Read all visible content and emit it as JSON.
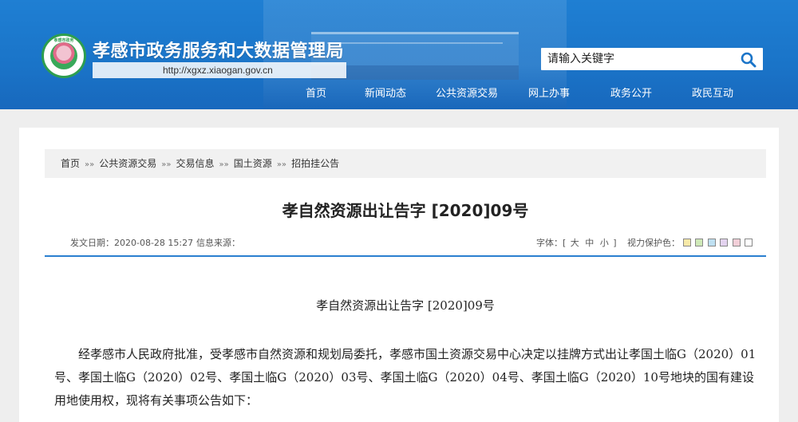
{
  "header": {
    "logo_text": "孝感市政务",
    "site_title": "孝感市政务服务和大数据管理局",
    "site_url": "http://xgxz.xiaogan.gov.cn",
    "search": {
      "placeholder": "请输入关键字"
    },
    "nav": [
      "首页",
      "新闻动态",
      "公共资源交易",
      "网上办事",
      "政务公开",
      "政民互动"
    ]
  },
  "breadcrumb": [
    "首页",
    "公共资源交易",
    "交易信息",
    "国土资源",
    "招拍挂公告"
  ],
  "breadcrumb_separator": "»»",
  "article": {
    "title": "孝自然资源出让告字 [2020]09号",
    "meta": {
      "date_label": "发文日期：2020-08-28 15:27",
      "source_label": "信息来源：",
      "font_label": "字体：[",
      "font_options": [
        "大",
        "中",
        "小"
      ],
      "font_close": "]",
      "vision_label": "视力保护色："
    },
    "vision_colors": [
      "#f7e9a8",
      "#cfe9b8",
      "#bfe0f2",
      "#e3d3ef",
      "#f2cfd8",
      "#ffffff"
    ],
    "doc_heading": "孝自然资源出让告字 [2020]09号",
    "paragraph": "经孝感市人民政府批准，受孝感市自然资源和规划局委托，孝感市国土资源交易中心决定以挂牌方式出让孝国土临G（2020）01号、孝国土临G（2020）02号、孝国土临G（2020）03号、孝国土临G（2020）04号、孝国土临G（2020）10号地块的国有建设用地使用权，现将有关事项公告如下："
  },
  "colors": {
    "header_blue": "#1a74c8",
    "divider_blue": "#2a7fd0"
  }
}
